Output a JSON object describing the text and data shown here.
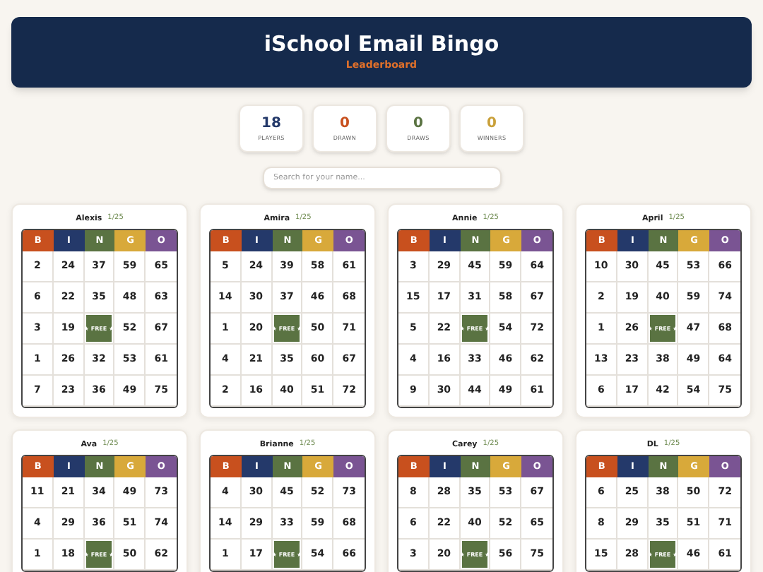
{
  "header": {
    "title": "iSchool Email Bingo",
    "subtitle": "Leaderboard"
  },
  "stats": [
    {
      "value": "18",
      "label": "PLAYERS",
      "color": "#24396a"
    },
    {
      "value": "0",
      "label": "DRAWN",
      "color": "#c8501e"
    },
    {
      "value": "0",
      "label": "DRAWS",
      "color": "#5a7342"
    },
    {
      "value": "0",
      "label": "WINNERS",
      "color": "#c9a03a"
    }
  ],
  "search": {
    "placeholder": "Search for your name..."
  },
  "cards": [
    {
      "name": "Alexis",
      "progress": "1/25",
      "columns": [
        {
          "letter": "B",
          "color": "#c8501e"
        },
        {
          "letter": "I",
          "color": "#24396a"
        },
        {
          "letter": "N",
          "color": "#5a7342"
        },
        {
          "letter": "G",
          "color": "#d8a93a"
        },
        {
          "letter": "O",
          "color": "#7a5493"
        }
      ],
      "rows": [
        [
          "2",
          "24",
          "37",
          "59",
          "65"
        ],
        [
          "6",
          "22",
          "35",
          "48",
          "63"
        ],
        [
          "3",
          "19",
          {
            "kind": "free",
            "text": "★ FREE ★"
          },
          "52",
          "67"
        ],
        [
          "1",
          "26",
          "32",
          "53",
          "61"
        ],
        [
          "7",
          "23",
          "36",
          "49",
          "75"
        ]
      ]
    },
    {
      "name": "Amira",
      "progress": "1/25",
      "columns": [
        {
          "letter": "B",
          "color": "#c8501e"
        },
        {
          "letter": "I",
          "color": "#24396a"
        },
        {
          "letter": "N",
          "color": "#5a7342"
        },
        {
          "letter": "G",
          "color": "#d8a93a"
        },
        {
          "letter": "O",
          "color": "#7a5493"
        }
      ],
      "rows": [
        [
          "5",
          "24",
          "39",
          "58",
          "61"
        ],
        [
          "14",
          "30",
          "37",
          "46",
          "68"
        ],
        [
          "1",
          "20",
          {
            "kind": "free",
            "text": "★ FREE ★"
          },
          "50",
          "71"
        ],
        [
          "4",
          "21",
          "35",
          "60",
          "67"
        ],
        [
          "2",
          "16",
          "40",
          "51",
          "72"
        ]
      ]
    },
    {
      "name": "Annie",
      "progress": "1/25",
      "columns": [
        {
          "letter": "B",
          "color": "#c8501e"
        },
        {
          "letter": "I",
          "color": "#24396a"
        },
        {
          "letter": "N",
          "color": "#5a7342"
        },
        {
          "letter": "G",
          "color": "#d8a93a"
        },
        {
          "letter": "O",
          "color": "#7a5493"
        }
      ],
      "rows": [
        [
          "3",
          "29",
          "45",
          "59",
          "64"
        ],
        [
          "15",
          "17",
          "31",
          "58",
          "67"
        ],
        [
          "5",
          "22",
          {
            "kind": "free",
            "text": "★ FREE ★"
          },
          "54",
          "72"
        ],
        [
          "4",
          "16",
          "33",
          "46",
          "62"
        ],
        [
          "9",
          "30",
          "44",
          "49",
          "61"
        ]
      ]
    },
    {
      "name": "April",
      "progress": "1/25",
      "columns": [
        {
          "letter": "B",
          "color": "#c8501e"
        },
        {
          "letter": "I",
          "color": "#24396a"
        },
        {
          "letter": "N",
          "color": "#5a7342"
        },
        {
          "letter": "G",
          "color": "#d8a93a"
        },
        {
          "letter": "O",
          "color": "#7a5493"
        }
      ],
      "rows": [
        [
          "10",
          "30",
          "45",
          "53",
          "66"
        ],
        [
          "2",
          "19",
          "40",
          "59",
          "74"
        ],
        [
          "1",
          "26",
          {
            "kind": "free",
            "text": "★ FREE ★"
          },
          "47",
          "68"
        ],
        [
          "13",
          "23",
          "38",
          "49",
          "64"
        ],
        [
          "6",
          "17",
          "42",
          "54",
          "75"
        ]
      ]
    },
    {
      "name": "Ava",
      "progress": "1/25",
      "columns": [
        {
          "letter": "B",
          "color": "#c8501e"
        },
        {
          "letter": "I",
          "color": "#24396a"
        },
        {
          "letter": "N",
          "color": "#5a7342"
        },
        {
          "letter": "G",
          "color": "#d8a93a"
        },
        {
          "letter": "O",
          "color": "#7a5493"
        }
      ],
      "rows": [
        [
          "11",
          "21",
          "34",
          "49",
          "73"
        ],
        [
          "4",
          "29",
          "36",
          "51",
          "74"
        ],
        [
          "1",
          "18",
          {
            "kind": "free",
            "text": "★ FREE ★"
          },
          "50",
          "62"
        ]
      ]
    },
    {
      "name": "Brianne",
      "progress": "1/25",
      "columns": [
        {
          "letter": "B",
          "color": "#c8501e"
        },
        {
          "letter": "I",
          "color": "#24396a"
        },
        {
          "letter": "N",
          "color": "#5a7342"
        },
        {
          "letter": "G",
          "color": "#d8a93a"
        },
        {
          "letter": "O",
          "color": "#7a5493"
        }
      ],
      "rows": [
        [
          "4",
          "30",
          "45",
          "52",
          "73"
        ],
        [
          "14",
          "29",
          "33",
          "59",
          "68"
        ],
        [
          "1",
          "17",
          {
            "kind": "free",
            "text": "★ FREE ★"
          },
          "54",
          "66"
        ]
      ]
    },
    {
      "name": "Carey",
      "progress": "1/25",
      "columns": [
        {
          "letter": "B",
          "color": "#c8501e"
        },
        {
          "letter": "I",
          "color": "#24396a"
        },
        {
          "letter": "N",
          "color": "#5a7342"
        },
        {
          "letter": "G",
          "color": "#d8a93a"
        },
        {
          "letter": "O",
          "color": "#7a5493"
        }
      ],
      "rows": [
        [
          "8",
          "28",
          "35",
          "53",
          "67"
        ],
        [
          "6",
          "22",
          "40",
          "52",
          "65"
        ],
        [
          "3",
          "20",
          {
            "kind": "free",
            "text": "★ FREE ★"
          },
          "56",
          "75"
        ]
      ]
    },
    {
      "name": "DL",
      "progress": "1/25",
      "columns": [
        {
          "letter": "B",
          "color": "#c8501e"
        },
        {
          "letter": "I",
          "color": "#24396a"
        },
        {
          "letter": "N",
          "color": "#5a7342"
        },
        {
          "letter": "G",
          "color": "#d8a93a"
        },
        {
          "letter": "O",
          "color": "#7a5493"
        }
      ],
      "rows": [
        [
          "6",
          "25",
          "38",
          "50",
          "72"
        ],
        [
          "8",
          "29",
          "35",
          "51",
          "71"
        ],
        [
          "15",
          "28",
          {
            "kind": "free",
            "text": "★ FREE ★"
          },
          "46",
          "61"
        ]
      ]
    }
  ]
}
